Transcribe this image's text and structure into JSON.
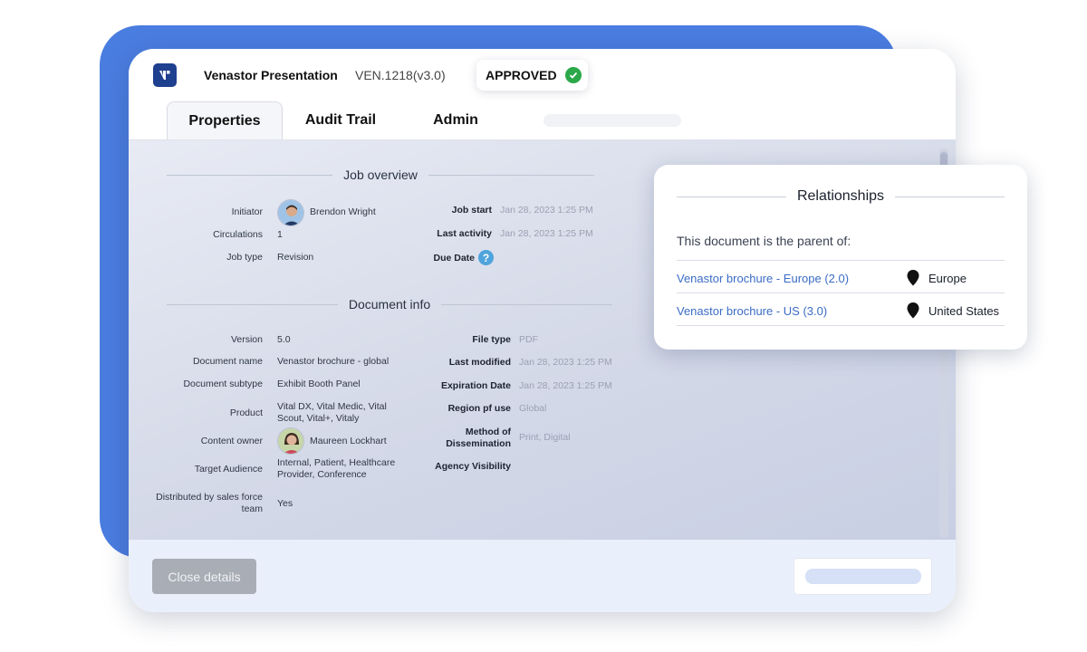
{
  "app": {
    "title": "Venastor Presentation",
    "doc_id": "VEN.1218(v3.0)",
    "status": "APPROVED"
  },
  "tabs": [
    {
      "label": "Properties",
      "active": true
    },
    {
      "label": "Audit Trail",
      "active": false
    },
    {
      "label": "Admin",
      "active": false
    }
  ],
  "job_overview": {
    "title": "Job overview",
    "left": [
      {
        "label": "Initiator",
        "value": "Brendon Wright"
      },
      {
        "label": "Circulations",
        "value": "1"
      },
      {
        "label": "Job type",
        "value": "Revision"
      }
    ],
    "right": [
      {
        "label": "Job start",
        "value": "Jan 28, 2023 1:25 PM"
      },
      {
        "label": "Last activity",
        "value": "Jan 28, 2023 1:25 PM"
      },
      {
        "label": "Due Date",
        "value": ""
      }
    ]
  },
  "document_info": {
    "title": "Document info",
    "left": [
      {
        "label": "Version",
        "value": "5.0"
      },
      {
        "label": "Document name",
        "value": "Venastor brochure - global"
      },
      {
        "label": "Document subtype",
        "value": "Exhibit Booth Panel"
      },
      {
        "label": "Product",
        "value": "Vital DX, Vital Medic, Vital Scout, Vital+, Vitaly"
      },
      {
        "label": "Content owner",
        "value": "Maureen Lockhart"
      },
      {
        "label": "Target Audience",
        "value": "Internal, Patient, Healthcare Provider, Conference"
      },
      {
        "label": "Distributed by sales force team",
        "value": "Yes"
      }
    ],
    "right": [
      {
        "label": "File type",
        "value": "PDF"
      },
      {
        "label": "Last modified",
        "value": "Jan 28, 2023 1:25 PM"
      },
      {
        "label": "Expiration Date",
        "value": "Jan 28, 2023 1:25 PM"
      },
      {
        "label": "Region pf use",
        "value": "Global"
      },
      {
        "label": "Method of Dissemination",
        "value": "Print, Digital"
      },
      {
        "label": "Agency Visibility",
        "value": ""
      }
    ]
  },
  "footer": {
    "close_label": "Close details"
  },
  "relationships": {
    "title": "Relationships",
    "subtitle": "This document is the parent of:",
    "items": [
      {
        "link": "Venastor brochure - Europe (2.0)",
        "region": "Europe"
      },
      {
        "link": "Venastor brochure - US (3.0)",
        "region": "United States"
      }
    ]
  },
  "icons": {
    "status": "check-circle-icon",
    "due_date": "help-icon",
    "region": "map-pin-icon"
  },
  "colors": {
    "brand": "#1f3f8f",
    "backdrop": "#4a7de0",
    "approved": "#2ba84a",
    "link": "#3b6cc6",
    "help": "#4fa4dc"
  }
}
